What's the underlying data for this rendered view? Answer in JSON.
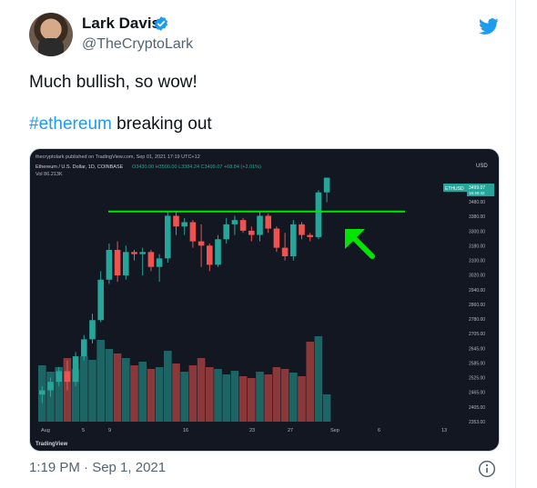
{
  "tweet": {
    "author_name": "Lark Davis",
    "author_handle": "@TheCryptoLark",
    "line1": "Much bullish, so wow!",
    "hashtag": "#ethereum",
    "line2_rest": " breaking out",
    "timestamp": "1:19 PM · Sep 1, 2021"
  },
  "chart_header": {
    "publish_line": "thecryptolark published on TradingView.com, Sep 01, 2021 17:19 UTC+12",
    "symbol_line": "Ethereum / U.S. Dollar, 1D, COINBASE",
    "ohlc": "O3430.00 H3500.00 L3384.24 C3499.07 +68.84 (+2.01%)",
    "vol": "Vol  86.213K",
    "currency": "USD",
    "price_tag": "3499.07",
    "price_tag_sub": "16:40:42",
    "symbol_tag": "ETHUSD",
    "watermark": "TradingView"
  },
  "colors": {
    "up": "#26a69a",
    "down": "#ef5350",
    "breakout_line": "#00e600",
    "arrow": "#00e600",
    "link": "#1d9bf0"
  },
  "chart_data": {
    "type": "candlestick",
    "y_ticks": [
      "3480.00",
      "3380.00",
      "3300.00",
      "3180.00",
      "3100.00",
      "3020.00",
      "2940.00",
      "2860.00",
      "2780.00",
      "2705.00",
      "2645.00",
      "2585.00",
      "2525.00",
      "2465.00",
      "2405.00",
      "2353.00"
    ],
    "x_ticks": [
      "Aug",
      "5",
      "9",
      "16",
      "23",
      "27",
      "Sep",
      "6",
      "13"
    ],
    "candles": [
      {
        "o": 2480,
        "h": 2520,
        "l": 2440,
        "c": 2500
      },
      {
        "o": 2500,
        "h": 2560,
        "l": 2470,
        "c": 2540
      },
      {
        "o": 2540,
        "h": 2610,
        "l": 2520,
        "c": 2590
      },
      {
        "o": 2590,
        "h": 2640,
        "l": 2500,
        "c": 2540
      },
      {
        "o": 2540,
        "h": 2680,
        "l": 2520,
        "c": 2660
      },
      {
        "o": 2660,
        "h": 2760,
        "l": 2640,
        "c": 2740
      },
      {
        "o": 2740,
        "h": 2860,
        "l": 2720,
        "c": 2830
      },
      {
        "o": 2830,
        "h": 3060,
        "l": 2820,
        "c": 3020
      },
      {
        "o": 3020,
        "h": 3190,
        "l": 3000,
        "c": 3160
      },
      {
        "o": 3160,
        "h": 3200,
        "l": 3010,
        "c": 3040
      },
      {
        "o": 3040,
        "h": 3180,
        "l": 3020,
        "c": 3150
      },
      {
        "o": 3150,
        "h": 3160,
        "l": 3110,
        "c": 3140
      },
      {
        "o": 3140,
        "h": 3170,
        "l": 3040,
        "c": 3150
      },
      {
        "o": 3150,
        "h": 3160,
        "l": 3060,
        "c": 3080
      },
      {
        "o": 3080,
        "h": 3140,
        "l": 3010,
        "c": 3120
      },
      {
        "o": 3120,
        "h": 3340,
        "l": 3100,
        "c": 3320
      },
      {
        "o": 3320,
        "h": 3340,
        "l": 3230,
        "c": 3270
      },
      {
        "o": 3270,
        "h": 3310,
        "l": 3230,
        "c": 3290
      },
      {
        "o": 3290,
        "h": 3300,
        "l": 3170,
        "c": 3200
      },
      {
        "o": 3200,
        "h": 3280,
        "l": 3080,
        "c": 3180
      },
      {
        "o": 3180,
        "h": 3190,
        "l": 3060,
        "c": 3090
      },
      {
        "o": 3090,
        "h": 3230,
        "l": 3080,
        "c": 3210
      },
      {
        "o": 3210,
        "h": 3310,
        "l": 3190,
        "c": 3280
      },
      {
        "o": 3280,
        "h": 3320,
        "l": 3230,
        "c": 3300
      },
      {
        "o": 3300,
        "h": 3310,
        "l": 3240,
        "c": 3250
      },
      {
        "o": 3250,
        "h": 3270,
        "l": 3200,
        "c": 3230
      },
      {
        "o": 3230,
        "h": 3340,
        "l": 3200,
        "c": 3320
      },
      {
        "o": 3320,
        "h": 3330,
        "l": 3240,
        "c": 3260
      },
      {
        "o": 3260,
        "h": 3270,
        "l": 3150,
        "c": 3170
      },
      {
        "o": 3170,
        "h": 3240,
        "l": 3110,
        "c": 3130
      },
      {
        "o": 3130,
        "h": 3300,
        "l": 3110,
        "c": 3280
      },
      {
        "o": 3280,
        "h": 3290,
        "l": 3210,
        "c": 3230
      },
      {
        "o": 3230,
        "h": 3240,
        "l": 3200,
        "c": 3220
      },
      {
        "o": 3220,
        "h": 3440,
        "l": 3210,
        "c": 3430
      },
      {
        "o": 3430,
        "h": 3500,
        "l": 3384,
        "c": 3499
      }
    ],
    "volume": [
      62,
      55,
      60,
      70,
      58,
      72,
      68,
      90,
      80,
      75,
      70,
      62,
      66,
      58,
      60,
      78,
      64,
      55,
      62,
      70,
      60,
      58,
      52,
      56,
      50,
      48,
      55,
      52,
      60,
      58,
      54,
      50,
      88,
      94,
      30
    ],
    "breakout_level": 3340
  }
}
